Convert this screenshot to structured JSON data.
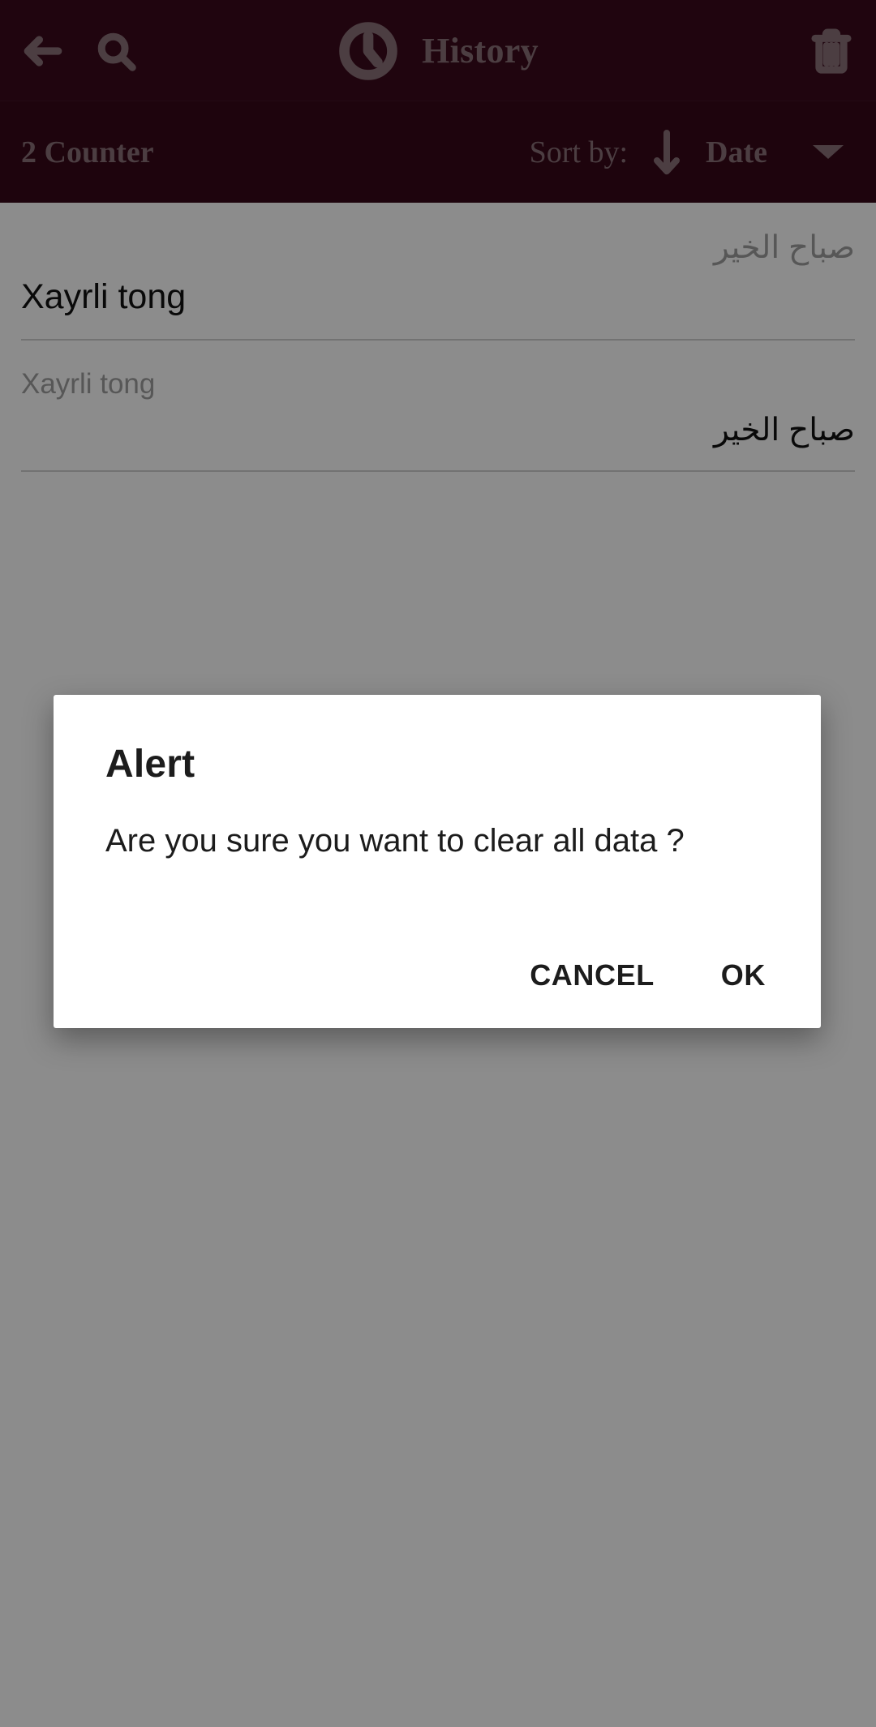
{
  "appbar": {
    "back_icon": "back-arrow-icon",
    "search_icon": "search-icon",
    "clock_icon": "clock-icon",
    "title": "History",
    "delete_icon": "trash-icon",
    "background_color": "#3b0a1c",
    "foreground_color": "#8a7178"
  },
  "sortbar": {
    "counter_label": "2 Counter",
    "sort_by_label": "Sort by:",
    "sort_direction_icon": "arrow-down-icon",
    "sort_value": "Date",
    "caret_icon": "caret-down-icon",
    "background_color": "#370818"
  },
  "history": {
    "items": [
      {
        "source_text": "صباح الخير",
        "source_dir": "rtl",
        "target_text": "Xayrli tong",
        "target_dir": "ltr"
      },
      {
        "source_text": "Xayrli tong",
        "source_dir": "ltr",
        "target_text": "صباح الخير",
        "target_dir": "rtl"
      }
    ]
  },
  "dialog": {
    "title": "Alert",
    "message": "Are you sure you want to clear all data ?",
    "cancel_label": "CANCEL",
    "ok_label": "OK",
    "background_color": "#ffffff",
    "text_color": "#1c1c1c"
  }
}
